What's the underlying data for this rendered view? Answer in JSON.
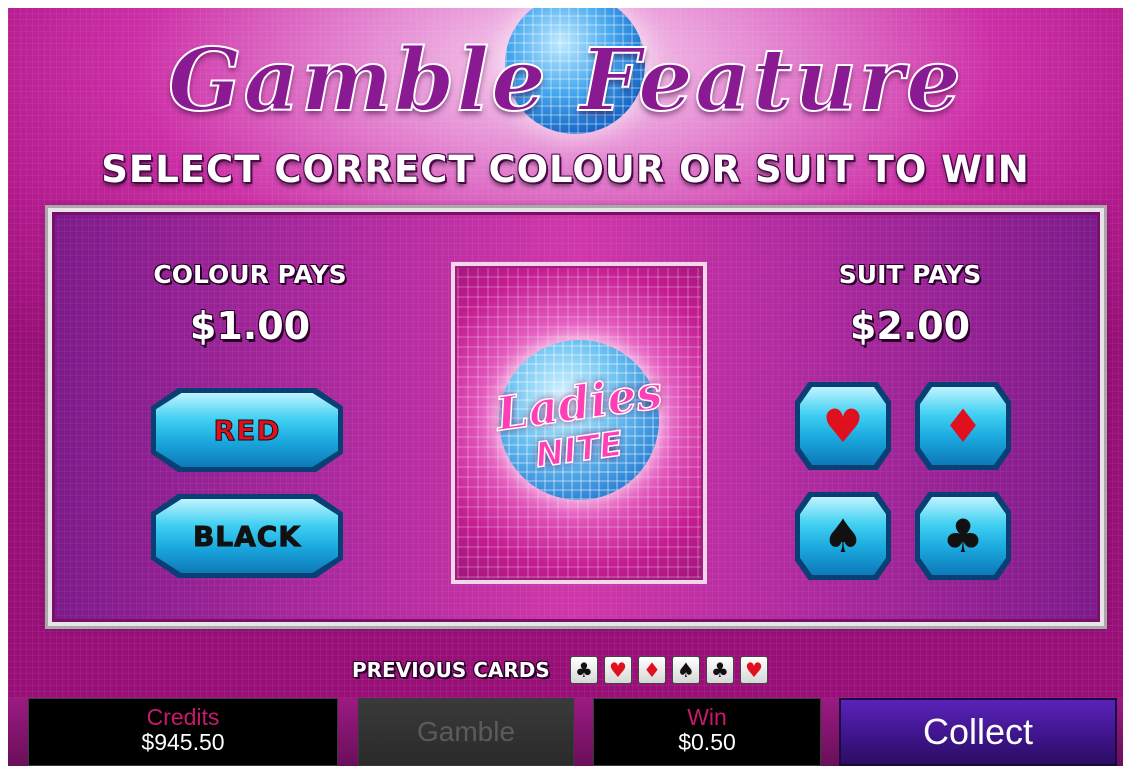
{
  "header": {
    "title": "Gamble Feature",
    "subtitle": "SELECT CORRECT COLOUR OR SUIT TO WIN"
  },
  "colour_pays": {
    "label": "COLOUR PAYS",
    "value": "$1.00",
    "buttons": [
      {
        "label": "RED",
        "color": "#e0101f"
      },
      {
        "label": "BLACK",
        "color": "#111111"
      }
    ]
  },
  "suit_pays": {
    "label": "SUIT PAYS",
    "value": "$2.00",
    "suits": [
      {
        "icon": "heart-icon",
        "glyph": "♥",
        "color": "#e0101f"
      },
      {
        "icon": "diamond-icon",
        "glyph": "♦",
        "color": "#e0101f"
      },
      {
        "icon": "spade-icon",
        "glyph": "♠",
        "color": "#111111"
      },
      {
        "icon": "club-icon",
        "glyph": "♣",
        "color": "#111111"
      }
    ]
  },
  "card": {
    "logo_line1": "Ladies",
    "logo_line2": "NITE"
  },
  "previous_cards": {
    "label": "PREVIOUS CARDS",
    "cards": [
      {
        "icon": "club-icon",
        "glyph": "♣",
        "color": "#111111"
      },
      {
        "icon": "heart-icon",
        "glyph": "♥",
        "color": "#e0101f"
      },
      {
        "icon": "diamond-icon",
        "glyph": "♦",
        "color": "#e0101f"
      },
      {
        "icon": "spade-icon",
        "glyph": "♠",
        "color": "#111111"
      },
      {
        "icon": "club-icon",
        "glyph": "♣",
        "color": "#111111"
      },
      {
        "icon": "heart-icon",
        "glyph": "♥",
        "color": "#e0101f"
      }
    ]
  },
  "bottom_bar": {
    "credits_label": "Credits",
    "credits_value": "$945.50",
    "gamble_label": "Gamble",
    "win_label": "Win",
    "win_value": "$0.50",
    "collect_label": "Collect"
  }
}
